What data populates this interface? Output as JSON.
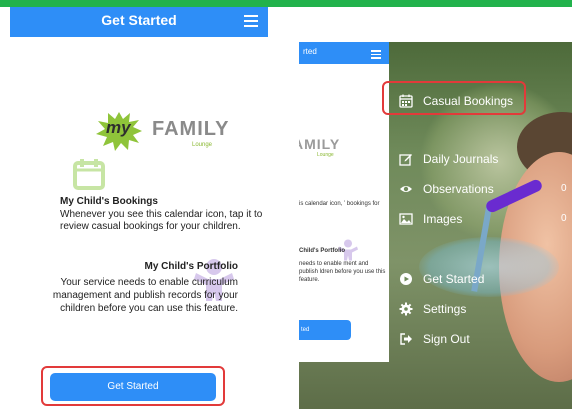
{
  "left": {
    "header_title": "Get Started",
    "logo": {
      "my": "my",
      "family": "FAMILY",
      "lounge": "Lounge"
    },
    "bookings_title": "My Child's Bookings",
    "bookings_text": "Whenever you see this calendar icon, tap it to review casual bookings for your children.",
    "portfolio_title": "My Child's Portfolio",
    "portfolio_text": "Your service needs to enable curriculum management and publish records for your children before you can use this feature.",
    "button_label": "Get Started"
  },
  "right": {
    "mini_title": "rted",
    "mini_logo": "AMILY",
    "mini_lounge": "Lounge",
    "mini_text1": "is calendar icon, ’ bookings for",
    "mini_portfolio_title": "Child's Portfolio",
    "mini_text2": "needs to enable ment and publish ldren before you use this feature.",
    "mini_button": "ted",
    "menu": [
      {
        "label": "Casual Bookings",
        "icon": "calendar-icon"
      },
      {
        "label": "Daily Journals",
        "icon": "edit-icon"
      },
      {
        "label": "Observations",
        "icon": "eye-icon"
      },
      {
        "label": "Images",
        "icon": "image-icon"
      },
      {
        "label": "Get Started",
        "icon": "play-circle-icon"
      },
      {
        "label": "Settings",
        "icon": "gear-icon"
      },
      {
        "label": "Sign Out",
        "icon": "sign-out-icon"
      }
    ],
    "counts": [
      "0",
      "0"
    ]
  },
  "colors": {
    "accent_blue": "#2e8ef7",
    "highlight_red": "#e23a3a",
    "brand_green": "#22b24c"
  }
}
